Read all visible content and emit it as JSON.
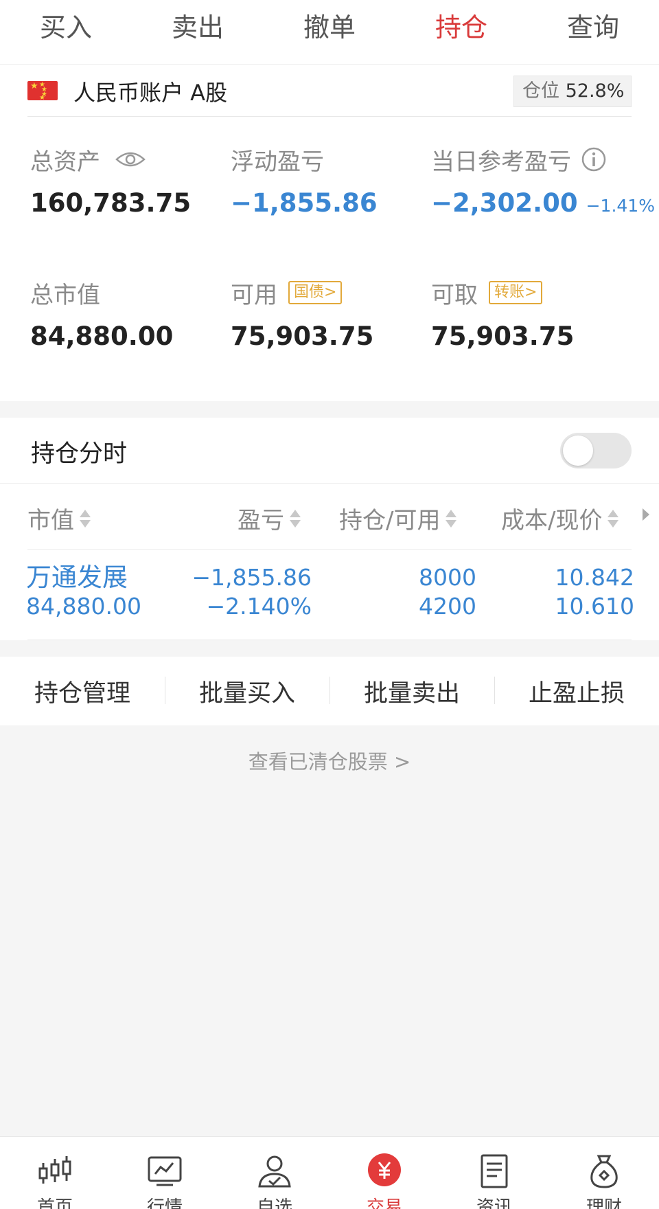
{
  "top_tabs": [
    {
      "label": "买入"
    },
    {
      "label": "卖出"
    },
    {
      "label": "撤单"
    },
    {
      "label": "持仓",
      "active": true
    },
    {
      "label": "查询"
    }
  ],
  "account": {
    "label": "人民币账户 A股",
    "position_key": "仓位",
    "position_value": "52.8%"
  },
  "assets": {
    "total_assets": {
      "label": "总资产",
      "value": "160,783.75"
    },
    "floating_pnl": {
      "label": "浮动盈亏",
      "value": "−1,855.86"
    },
    "daily_pnl": {
      "label": "当日参考盈亏",
      "value": "−2,302.00",
      "percent": "−1.41%"
    },
    "market_value": {
      "label": "总市值",
      "value": "84,880.00"
    },
    "available": {
      "label": "可用",
      "tag": "国债>",
      "value": "75,903.75"
    },
    "withdrawable": {
      "label": "可取",
      "tag": "转账>",
      "value": "75,903.75"
    }
  },
  "holding_timeshare": {
    "label": "持仓分时",
    "enabled": false
  },
  "table": {
    "headers": [
      "市值",
      "盈亏",
      "持仓/可用",
      "成本/现价"
    ],
    "rows": [
      {
        "name": "万通发展",
        "market_value": "84,880.00",
        "pnl": "−1,855.86",
        "pnl_pct": "−2.140%",
        "holding": "8000",
        "available": "4200",
        "cost": "10.842",
        "price": "10.610"
      }
    ]
  },
  "actions": [
    "持仓管理",
    "批量买入",
    "批量卖出",
    "止盈止损"
  ],
  "cleared_link": "查看已清仓股票 >",
  "colors": {
    "accent_red": "#d93a3a",
    "value_blue": "#3a86d2",
    "tag_gold": "#e2a93a"
  },
  "bottom_nav": [
    {
      "label": "首页",
      "icon": "candlestick-icon"
    },
    {
      "label": "行情",
      "icon": "chart-monitor-icon"
    },
    {
      "label": "自选",
      "icon": "user-check-icon"
    },
    {
      "label": "交易",
      "icon": "yuan-circle-icon",
      "active": true
    },
    {
      "label": "资讯",
      "icon": "document-icon"
    },
    {
      "label": "理财",
      "icon": "money-bag-icon"
    }
  ]
}
